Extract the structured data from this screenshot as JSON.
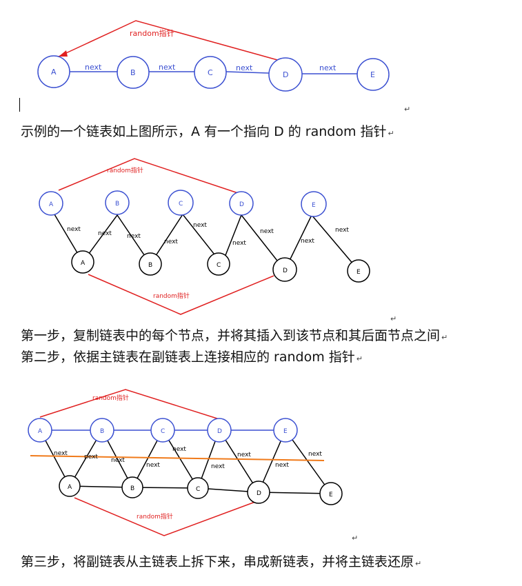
{
  "labels": {
    "next": "next",
    "random": "random指针",
    "nodes": [
      "A",
      "B",
      "C",
      "D",
      "E"
    ]
  },
  "return_mark": "↵",
  "captions": {
    "example": "示例的一个链表如上图所示，A 有一个指向 D 的 random 指针",
    "step1": "第一步，复制链表中的每个节点，并将其插入到该节点和其后面节点之间",
    "step2": "第二步，依据主链表在副链表上连接相应的 random 指针",
    "step3": "第三步，将副链表从主链表上拆下来，串成新链表，并将主链表还原"
  },
  "colors": {
    "original_node": "#3a4fd1",
    "copy_node": "#000000",
    "random_pointer": "#e02020",
    "split_line": "#f07a1a"
  }
}
